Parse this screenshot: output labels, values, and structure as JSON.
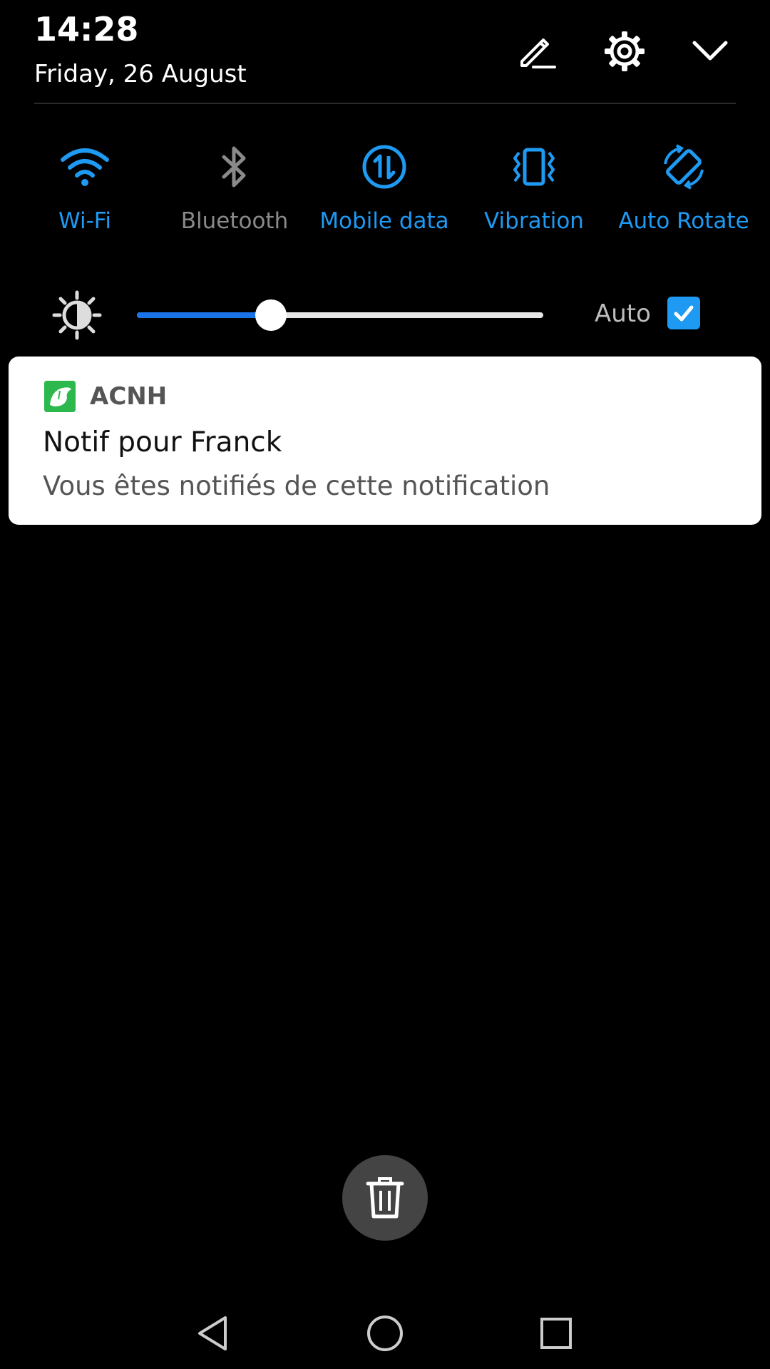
{
  "status": {
    "time": "14:28",
    "date": "Friday, 26 August"
  },
  "header_icons": [
    "edit-pencil-icon",
    "settings-gear-icon",
    "collapse-chevron-icon"
  ],
  "quick_toggles": [
    {
      "label": "Wi-Fi",
      "icon": "wifi-icon",
      "active": true
    },
    {
      "label": "Bluetooth",
      "icon": "bluetooth-icon",
      "active": false
    },
    {
      "label": "Mobile data",
      "icon": "mobile-data-icon",
      "active": true
    },
    {
      "label": "Vibration",
      "icon": "vibration-icon",
      "active": true
    },
    {
      "label": "Auto Rotate",
      "icon": "auto-rotate-icon",
      "active": true
    }
  ],
  "brightness": {
    "level": 0.33,
    "auto_label": "Auto",
    "auto_checked": true
  },
  "notification": {
    "app_name": "ACNH",
    "title": "Notif pour Franck",
    "body": "Vous êtes notifiés de cette notification"
  },
  "colors": {
    "accent": "#1e9af3",
    "inactive": "#8a8a8a",
    "background": "#000000",
    "card": "#ffffff"
  },
  "nav_icons": [
    "back-icon",
    "home-icon",
    "recents-icon"
  ]
}
